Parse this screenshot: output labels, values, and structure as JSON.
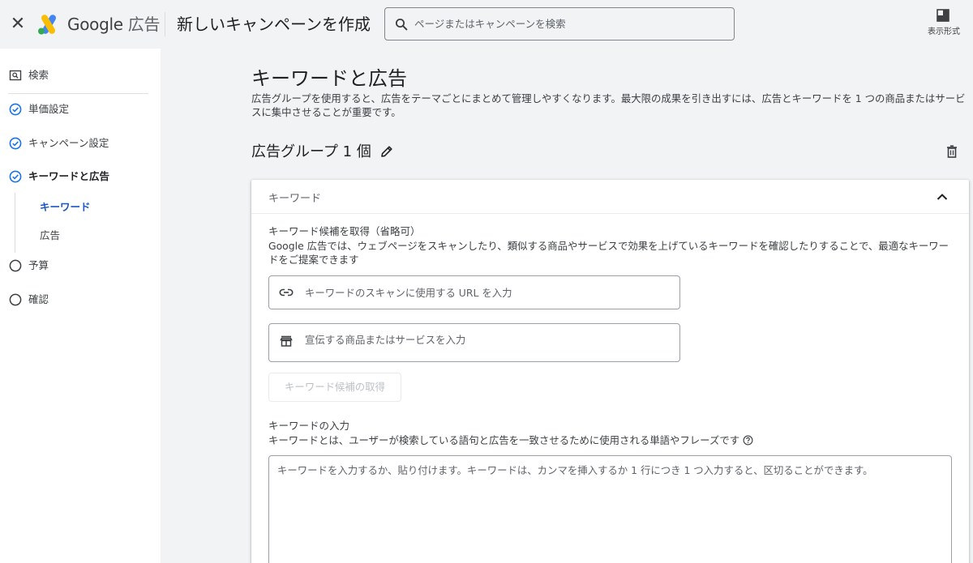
{
  "header": {
    "close_icon": "close-icon",
    "brand_google": "Google",
    "brand_product": "広告",
    "page_title": "新しいキャンペーンを作成",
    "search": {
      "placeholder": "ページまたはキャンペーンを検索",
      "value": ""
    },
    "view_label": "表示形式"
  },
  "sidebar": {
    "items": [
      {
        "label": "検索",
        "icon": "search-box-icon",
        "state": "default"
      },
      {
        "label": "単価設定",
        "icon": "check-circle-icon",
        "state": "done"
      },
      {
        "label": "キャンペーン設定",
        "icon": "check-circle-icon",
        "state": "done"
      },
      {
        "label": "キーワードと広告",
        "icon": "check-circle-icon",
        "state": "active"
      },
      {
        "label": "予算",
        "icon": "empty-circle-icon",
        "state": "pending"
      },
      {
        "label": "確認",
        "icon": "empty-circle-icon",
        "state": "pending"
      }
    ],
    "subitems": [
      {
        "label": "キーワード",
        "state": "active"
      },
      {
        "label": "広告",
        "state": "default"
      }
    ]
  },
  "main": {
    "title": "キーワードと広告",
    "description": "広告グループを使用すると、広告をテーマごとにまとめて管理しやすくなります。最大限の成果を引き出すには、広告とキーワードを 1 つの商品またはサービスに集中させることが重要です。",
    "ad_group_title": "広告グループ 1 個",
    "card": {
      "header_label": "キーワード",
      "suggest_title": "キーワード候補を取得（省略可）",
      "suggest_desc": "Google 広告では、ウェブページをスキャンしたり、類似する商品やサービスで効果を上げているキーワードを確認したりすることで、最適なキーワードをご提案できます",
      "url_input": {
        "placeholder": "キーワードのスキャンに使用する URL を入力",
        "value": "",
        "icon": "link-icon"
      },
      "product_input": {
        "placeholder": "宣伝する商品またはサービスを入力",
        "value": "",
        "icon": "store-icon"
      },
      "get_button": "キーワード候補の取得",
      "enter_title": "キーワードの入力",
      "enter_desc": "キーワードとは、ユーザーが検索している語句と広告を一致させるために使用される単語やフレーズです",
      "textarea_placeholder": "キーワードを入力するか、貼り付けます。キーワードは、カンマを挿入するか 1 行につき 1 つ入力すると、区切ることができます。"
    }
  },
  "colors": {
    "accent": "#1a57c5",
    "check": "#1a73e8",
    "page_bg": "#f1f3f4",
    "google_blue": "#4285f4",
    "google_yellow": "#fbbc04",
    "google_green": "#34a853"
  }
}
